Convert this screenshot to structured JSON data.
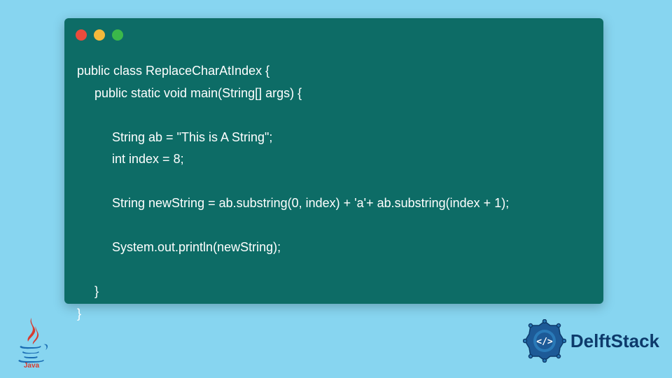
{
  "code": {
    "lines": [
      "public class ReplaceCharAtIndex {",
      "     public static void main(String[] args) {",
      "",
      "          String ab = \"This is A String\";",
      "          int index = 8;",
      "",
      "          String newString = ab.substring(0, index) + 'a'+ ab.substring(index + 1);",
      "",
      "          System.out.println(newString);",
      "",
      "     }",
      "}"
    ]
  },
  "brand": {
    "name": "DelftStack"
  },
  "logos": {
    "java_label": "Java"
  }
}
